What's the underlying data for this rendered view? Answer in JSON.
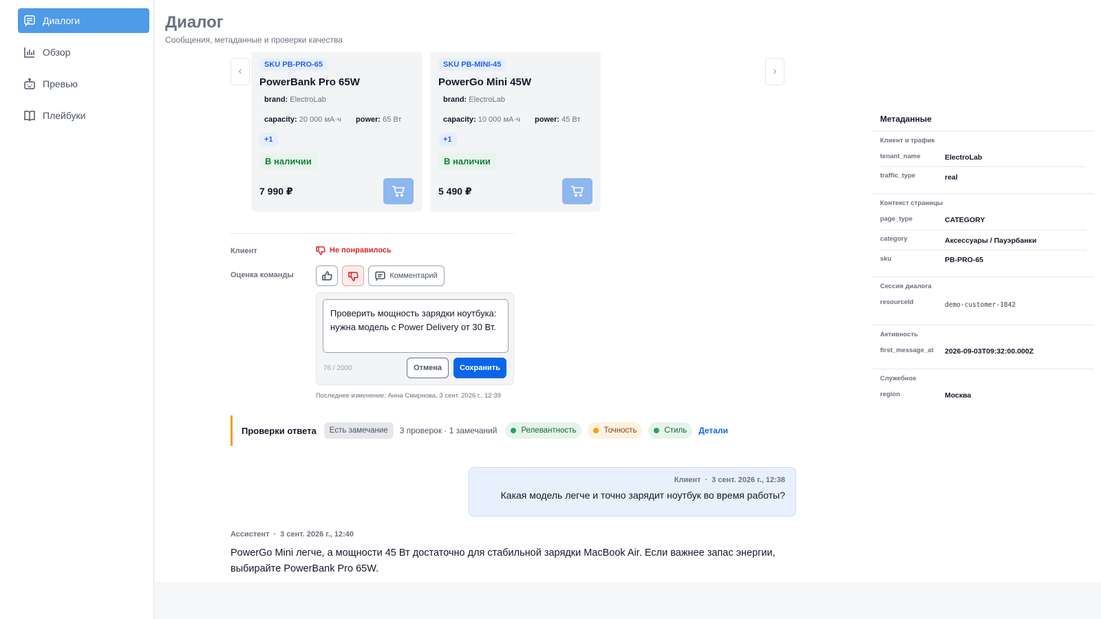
{
  "sidebar": {
    "items": [
      {
        "label": "Диалоги",
        "icon": "chat-icon",
        "active": true
      },
      {
        "label": "Обзор",
        "icon": "bar-chart-icon",
        "active": false
      },
      {
        "label": "Превью",
        "icon": "bot-icon",
        "active": false
      },
      {
        "label": "Плейбуки",
        "icon": "book-icon",
        "active": false
      }
    ]
  },
  "header": {
    "title": "Диалог",
    "subtitle": "Сообщения, метаданные и проверки качества"
  },
  "carousel": {
    "prev_icon": "‹",
    "next_icon": "›",
    "cards": [
      {
        "sku": "SKU PB-PRO-65",
        "title": "PowerBank Pro 65W",
        "brand_label": "brand:",
        "brand": "ElectroLab",
        "capacity_label": "capacity:",
        "capacity": "20 000 мА·ч",
        "power_label": "power:",
        "power": "65 Вт",
        "more": "+1",
        "stock": "В наличии",
        "price": "7 990 ₽"
      },
      {
        "sku": "SKU PB-MINI-45",
        "title": "PowerGo Mini 45W",
        "brand_label": "brand:",
        "brand": "ElectroLab",
        "capacity_label": "capacity:",
        "capacity": "10 000 мА·ч",
        "power_label": "power:",
        "power": "45 Вт",
        "more": "+1",
        "stock": "В наличии",
        "price": "5 490 ₽"
      }
    ]
  },
  "feedback": {
    "client_label": "Клиент",
    "client_rating": "Не понравилось",
    "team_label": "Оценка команды",
    "comment_button": "Комментарий",
    "comment_text": "Проверить мощность зарядки ноутбука: нужна модель с Power Delivery от 30 Вт.",
    "counter": "76 / 2000",
    "cancel": "Отмена",
    "save": "Сохранить",
    "last_edit": "Последнее изменение: Анна Смирнова, 3 сент. 2026 г., 12:39"
  },
  "checks": {
    "title": "Проверки ответа",
    "status": "Есть замечание",
    "summary": "3 проверок · 1 замечаний",
    "items": [
      {
        "label": "Релевантность",
        "status": "ok",
        "color": "#22a55b"
      },
      {
        "label": "Точность",
        "status": "warning",
        "color": "#f59e0b"
      },
      {
        "label": "Стиль",
        "status": "ok",
        "color": "#22a55b"
      }
    ],
    "details": "Детали"
  },
  "messages": {
    "client": {
      "author": "Клиент",
      "separator": "·",
      "time": "3 сент. 2026 г., 12:38",
      "text": "Какая модель легче и точно зарядит ноутбук во время работы?"
    },
    "assistant": {
      "author": "Ассистент",
      "separator": "·",
      "time": "3 сент. 2026 г., 12:40",
      "text": "PowerGo Mini легче, а мощности 45 Вт достаточно для стабильной зарядки MacBook Air. Если важнее запас энергии, выбирайте PowerBank Pro 65W."
    }
  },
  "metadata": {
    "title": "Метаданные",
    "sections": [
      {
        "title": "Клиент и трафик",
        "rows": [
          {
            "key": "tenant_name",
            "value": "ElectroLab"
          },
          {
            "key": "traffic_type",
            "value": "real"
          }
        ]
      },
      {
        "title": "Контекст страницы",
        "rows": [
          {
            "key": "page_type",
            "value": "CATEGORY"
          },
          {
            "key": "category",
            "value": "Аксессуары / Пауэрбанки"
          },
          {
            "key": "sku",
            "value": "PB-PRO-65"
          }
        ]
      },
      {
        "title": "Сессия диалога",
        "rows": [
          {
            "key": "resourceId",
            "value": "demo-customer-1842"
          }
        ]
      },
      {
        "title": "Активность",
        "rows": [
          {
            "key": "first_message_at",
            "value": "2026-09-03T09:32:00.000Z"
          }
        ]
      },
      {
        "title": "Служебное",
        "rows": [
          {
            "key": "region",
            "value": "Москва"
          }
        ]
      }
    ]
  },
  "colors": {
    "accent": "#0a66e8",
    "nav_active": "#4e9be8",
    "danger": "#dc2626",
    "success": "#15803d",
    "warning": "#f59e0b"
  }
}
